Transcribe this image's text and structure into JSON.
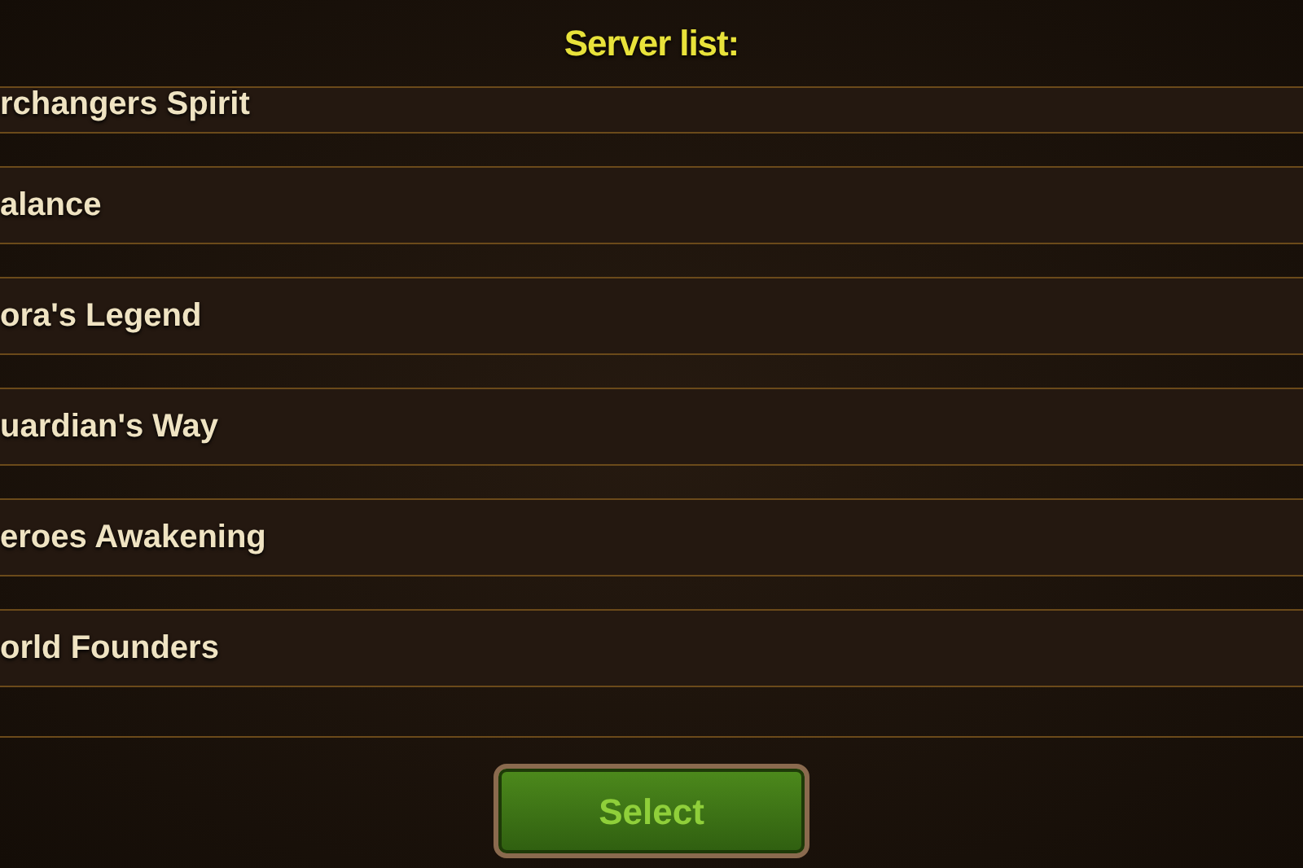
{
  "title": "Server list:",
  "servers": [
    {
      "name": "rchangers Spirit"
    },
    {
      "name": "alance"
    },
    {
      "name": "ora's Legend"
    },
    {
      "name": "uardian's Way"
    },
    {
      "name": "eroes Awakening"
    },
    {
      "name": "orld Founders"
    }
  ],
  "button": "Select"
}
